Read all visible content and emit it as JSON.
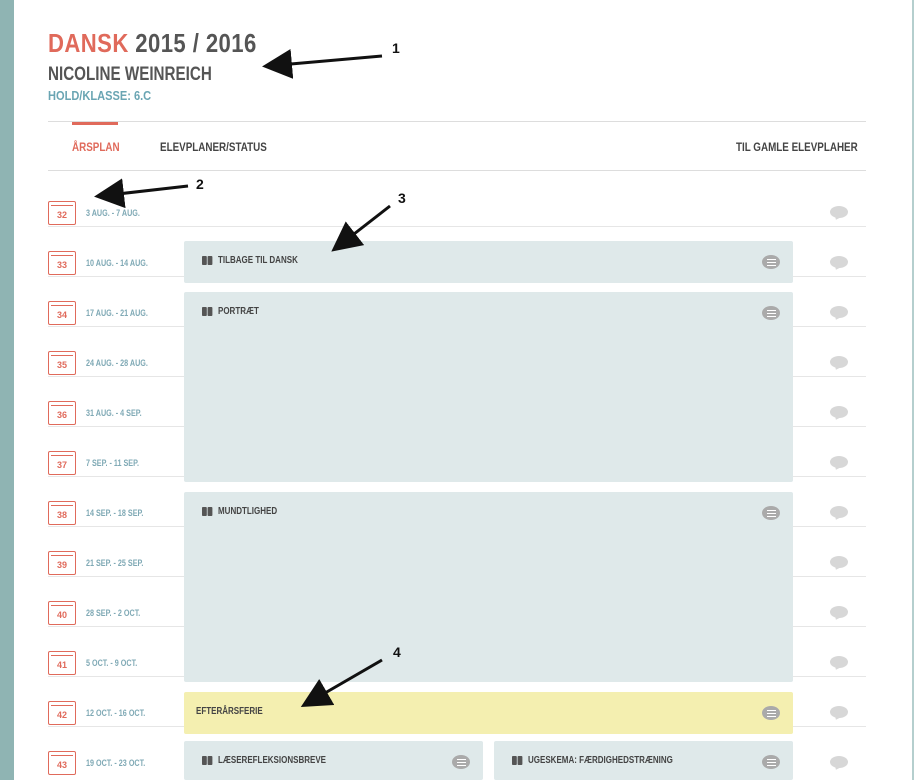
{
  "header": {
    "subject": "DANSK",
    "year": "2015 / 2016",
    "student": "NICOLINE WEINREICH",
    "klasse": "HOLD/KLASSE: 6.C"
  },
  "tabs": [
    {
      "label": "ÅRSPLAN",
      "active": true
    },
    {
      "label": "ELEVPLANER/STATUS",
      "active": false
    },
    {
      "label": "TIL GAMLE ELEVPLAHER",
      "active": false
    }
  ],
  "weeks": [
    {
      "num": "32",
      "range": "3 AUG. - 7 AUG."
    },
    {
      "num": "33",
      "range": "10 AUG. - 14 AUG."
    },
    {
      "num": "34",
      "range": "17 AUG. - 21 AUG."
    },
    {
      "num": "35",
      "range": "24 AUG. - 28 AUG."
    },
    {
      "num": "36",
      "range": "31 AUG. - 4 SEP."
    },
    {
      "num": "37",
      "range": "7 SEP. - 11 SEP."
    },
    {
      "num": "38",
      "range": "14 SEP. - 18 SEP."
    },
    {
      "num": "39",
      "range": "21 SEP. - 25 SEP."
    },
    {
      "num": "40",
      "range": "28 SEP. - 2 OCT."
    },
    {
      "num": "41",
      "range": "5 OCT. - 9 OCT."
    },
    {
      "num": "42",
      "range": "12 OCT. - 16 OCT."
    },
    {
      "num": "43",
      "range": "19 OCT. - 23 OCT."
    }
  ],
  "topics": {
    "tilbage": "TILBAGE TIL DANSK",
    "portraet": "PORTRÆT",
    "mundtlighed": "MUNDTLIGHED",
    "efterarsferie": "EFTERÅRSFERIE",
    "laesere": "LÆSEREFLEKSIONSBREVE",
    "ugeskema": "UGESKEMA: FÆRDIGHEDSTRÆNING"
  },
  "annotations": [
    "1",
    "2",
    "3",
    "4"
  ],
  "colors": {
    "accent": "#e06a5b",
    "teal": "#6aa5b3",
    "topic_bg": "#dfe9ea",
    "holiday_bg": "#f4efb0"
  },
  "icons": {
    "calendar": "calendar-icon",
    "book": "book-icon",
    "menu": "menu-icon",
    "comment": "comment-icon"
  }
}
